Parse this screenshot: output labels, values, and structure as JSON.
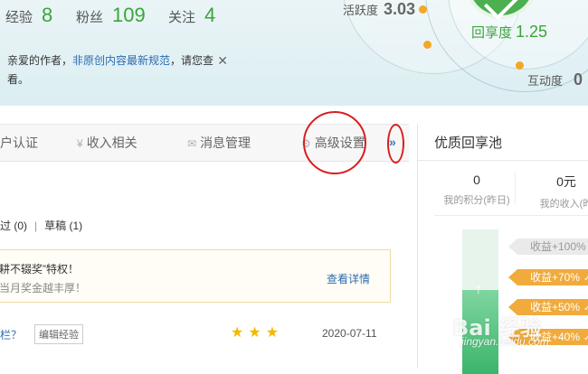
{
  "header": {
    "stats": [
      {
        "label": "经验",
        "value": "8"
      },
      {
        "label": "粉丝",
        "value": "109"
      },
      {
        "label": "关注",
        "value": "4"
      }
    ],
    "activity": {
      "label": "活跃度",
      "value": "3.03"
    },
    "share": {
      "label": "回享度",
      "value": "1.25"
    },
    "interaction": {
      "label": "互动度",
      "value": "0"
    },
    "notice": {
      "prefix": "亲爱的作者，",
      "link": "非原创内容最新规范",
      "suffix": "，请您查",
      "line2": "看。",
      "close": "✕"
    }
  },
  "tabs": [
    {
      "label": "户认证",
      "icon": ""
    },
    {
      "label": "收入相关",
      "icon": "yen-icon"
    },
    {
      "label": "消息管理",
      "icon": "mail-icon"
    },
    {
      "label": "高级设置",
      "icon": "gear-icon"
    }
  ],
  "tabs_more": "»",
  "filter": {
    "item1": "过 (0)",
    "sep": "|",
    "item2": "草稿 (1)"
  },
  "promo": {
    "line1": "耕不辍奖”特权！",
    "line2": "当月奖金越丰厚！",
    "link": "查看详情"
  },
  "row": {
    "title": "栏？",
    "tag": "编辑经验",
    "stars": "★★★",
    "date": "2020-07-11"
  },
  "pool": {
    "title": "优质回享池",
    "cells": [
      {
        "value": "0",
        "label": "我的积分(昨日)"
      },
      {
        "value": "0元",
        "label": "我的收入(昨"
      }
    ],
    "pills": [
      {
        "label": "收益+100%",
        "active": false
      },
      {
        "label": "收益+70%",
        "active": true
      },
      {
        "label": "收益+50%",
        "active": true
      },
      {
        "label": "收益+40%",
        "active": true
      }
    ],
    "check": "✓",
    "gauge_fill_fraction": 0.58
  },
  "watermark": {
    "brand": "Bai 经验",
    "url": "jingyan.baidu.com"
  },
  "colors": {
    "accent_green": "#3aa53a",
    "link_blue": "#2b6cb0",
    "pill_orange": "#f0ab3c",
    "annotation_red": "#d81e1e"
  }
}
